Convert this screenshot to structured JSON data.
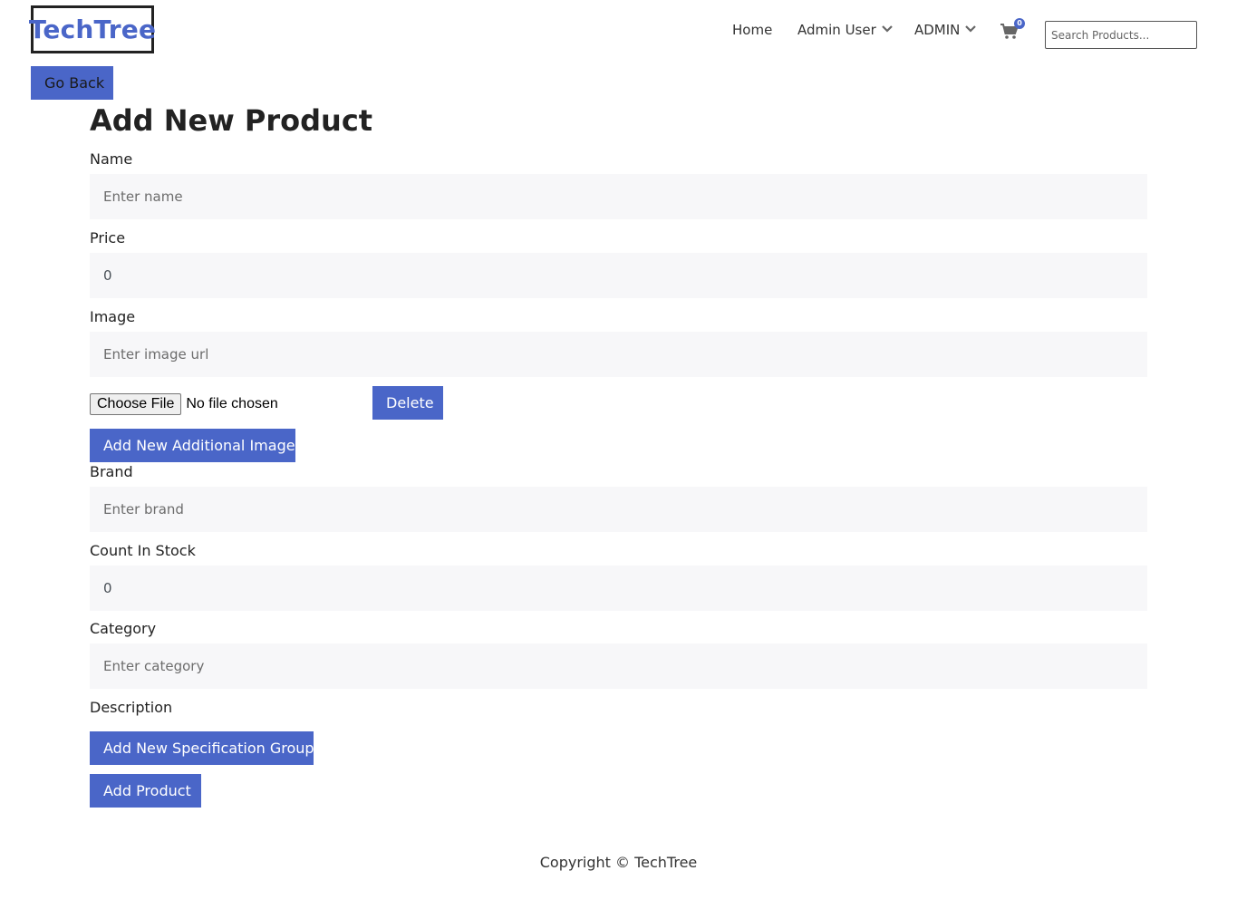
{
  "brand": {
    "logo_text": "TechTree",
    "accent_color": "#4a66c8"
  },
  "nav": {
    "home": "Home",
    "admin_user": "Admin User",
    "admin": "ADMIN",
    "cart_count": "0",
    "search_placeholder": "Search Products..."
  },
  "go_back_label": "Go Back",
  "page_title": "Add New Product",
  "form": {
    "name": {
      "label": "Name",
      "placeholder": "Enter name"
    },
    "price": {
      "label": "Price",
      "value": "0"
    },
    "image": {
      "label": "Image",
      "placeholder": "Enter image url"
    },
    "file": {
      "button_label": "Choose File",
      "status": "No file chosen"
    },
    "delete_label": "Delete",
    "add_additional_image_label": "Add New Additional Image",
    "brand": {
      "label": "Brand",
      "placeholder": "Enter brand"
    },
    "count_in_stock": {
      "label": "Count In Stock",
      "value": "0"
    },
    "category": {
      "label": "Category",
      "placeholder": "Enter category"
    },
    "description": {
      "label": "Description"
    },
    "add_spec_group_label": "Add New Specification Group",
    "submit_label": "Add Product"
  },
  "footer": {
    "copyright": "Copyright © TechTree"
  }
}
